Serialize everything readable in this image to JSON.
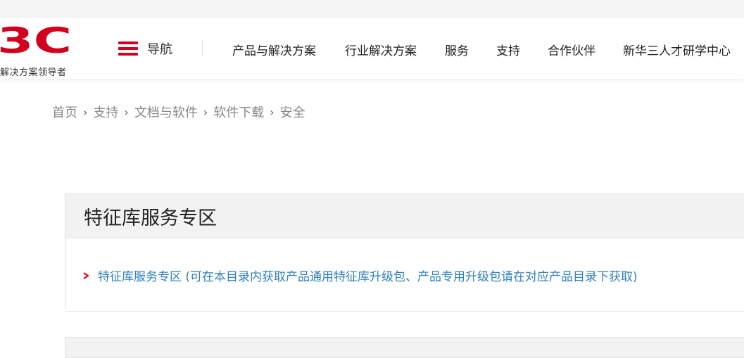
{
  "logo": {
    "mark_text": "3C",
    "tagline": "解决方案领导者",
    "brand_color": "#d2001e"
  },
  "nav": {
    "menu_label": "导航",
    "items": [
      "产品与解决方案",
      "行业解决方案",
      "服务",
      "支持",
      "合作伙伴",
      "新华三人才研学中心"
    ]
  },
  "breadcrumb": [
    "首页",
    "支持",
    "文档与软件",
    "软件下载",
    "安全"
  ],
  "breadcrumb_separator": "›",
  "panel": {
    "title": "特征库服务专区",
    "link_text": "特征库服务专区 (可在本目录内获取产品通用特征库升级包、产品专用升级包请在对应产品目录下获取)",
    "link_color": "#2f7fbf"
  }
}
